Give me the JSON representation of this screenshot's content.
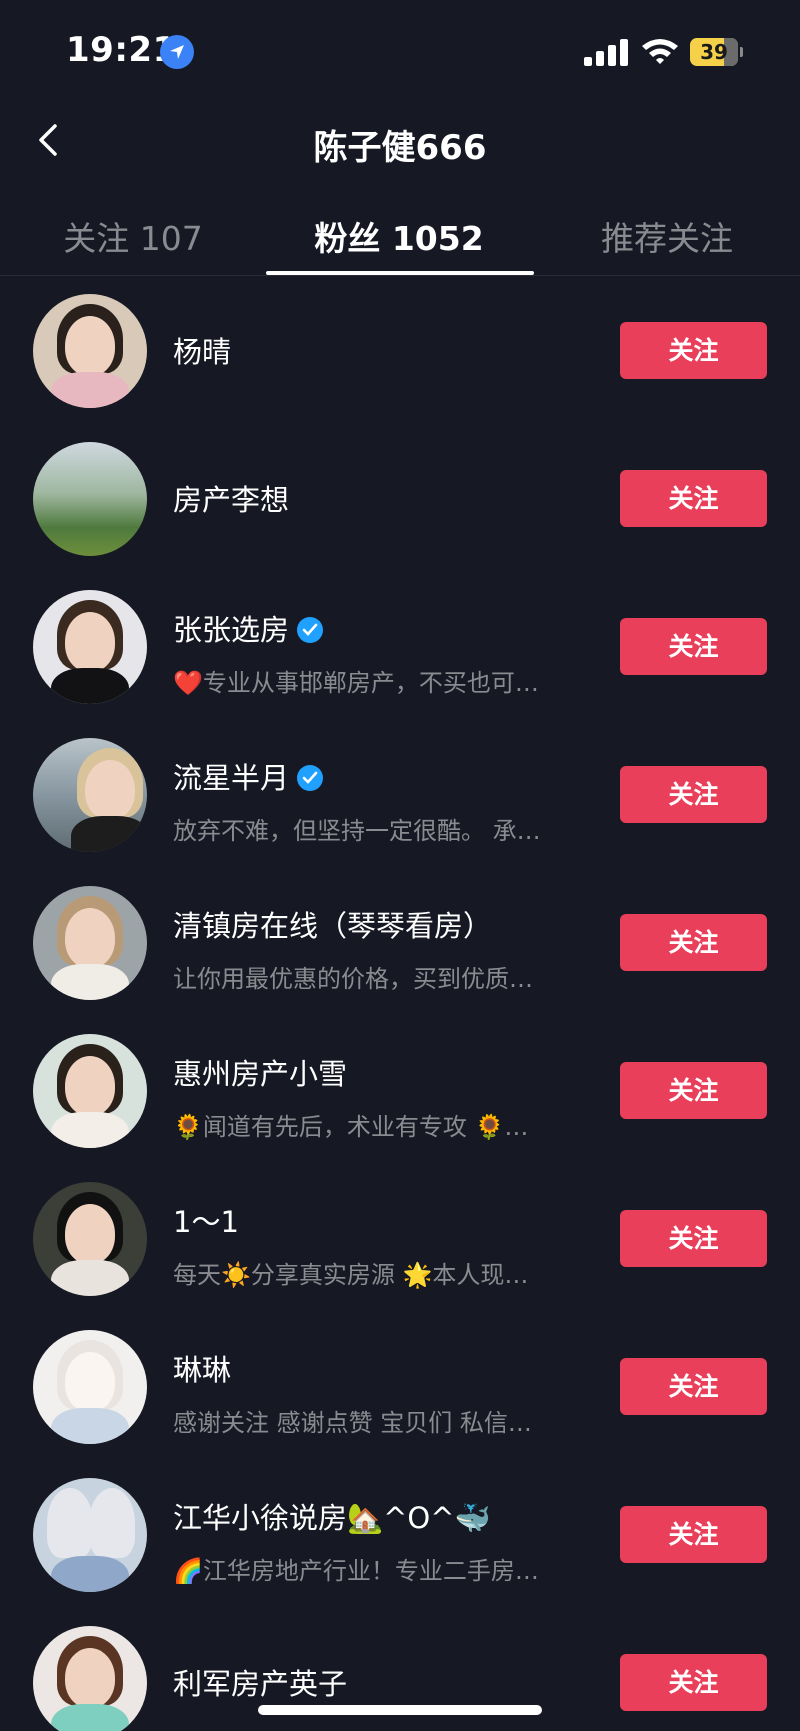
{
  "status_bar": {
    "time": "19:21",
    "battery": "39",
    "icons": [
      "location-arrow-icon",
      "cellular-signal-icon",
      "wifi-icon",
      "battery-icon"
    ]
  },
  "header": {
    "title": "陈子健666",
    "back_icon": "chevron-left-icon"
  },
  "tabs": [
    {
      "label": "关注 107",
      "active": false
    },
    {
      "label": "粉丝 1052",
      "active": true
    },
    {
      "label": "推荐关注",
      "active": false
    }
  ],
  "colors": {
    "background": "#161823",
    "follow_button": "#ea3f5a",
    "muted_text": "#8a8b91",
    "verified": "#20a0ff"
  },
  "followers": [
    {
      "name": "杨晴",
      "bio": "",
      "verified": false,
      "button": "关注"
    },
    {
      "name": "房产李想",
      "bio": "",
      "verified": false,
      "button": "关注"
    },
    {
      "name": "张张选房",
      "bio": "❤️专业从事邯郸房产，不买也可…",
      "verified": true,
      "button": "关注"
    },
    {
      "name": "流星半月",
      "bio": "放弃不难，但坚持一定很酷。 承…",
      "verified": true,
      "button": "关注"
    },
    {
      "name": "清镇房在线（琴琴看房）",
      "bio": "让你用最优惠的价格，买到优质…",
      "verified": false,
      "button": "关注"
    },
    {
      "name": "惠州房产小雪",
      "bio": "🌻闻道有先后，术业有专攻 🌻…",
      "verified": false,
      "button": "关注"
    },
    {
      "name": "1～1",
      "bio": "每天☀️分享真实房源 🌟本人现…",
      "verified": false,
      "button": "关注"
    },
    {
      "name": "琳琳",
      "bio": "感谢关注 感谢点赞 宝贝们 私信…",
      "verified": false,
      "button": "关注"
    },
    {
      "name": "江华小徐说房🏡^O^🐳",
      "bio": "🌈江华房地产行业！专业二手房…",
      "verified": false,
      "button": "关注"
    },
    {
      "name": "利军房产英子",
      "bio": "",
      "verified": false,
      "button": "关注"
    }
  ]
}
